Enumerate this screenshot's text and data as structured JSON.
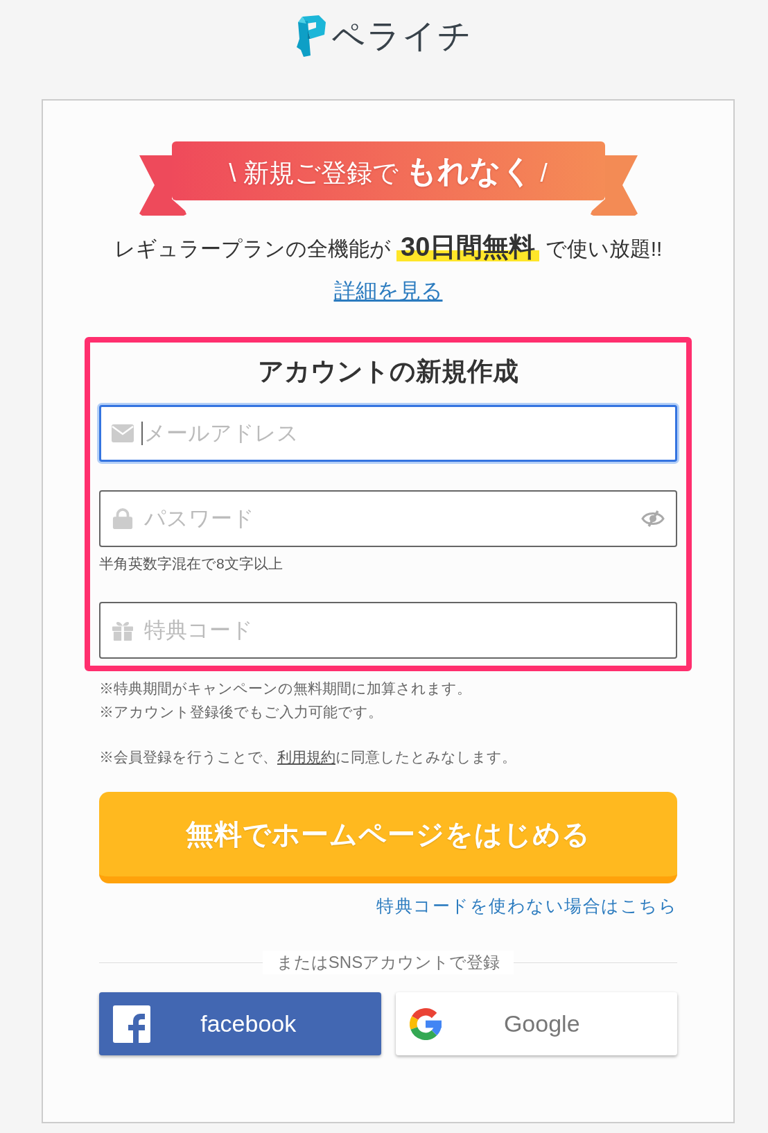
{
  "logo": {
    "wordmark": "ペライチ"
  },
  "banner": {
    "text": "\\ 新規ご登録で **もれなく** /"
  },
  "promo": {
    "text": "レギュラープランの全機能が **30日間無料** で使い放題!!",
    "link": "詳細を見る"
  },
  "signup_form": {
    "highlighted": true,
    "title": "アカウントの新規作成",
    "fields": [
      {
        "kind": "email",
        "placeholder": "メールアドレス",
        "focused": true
      },
      {
        "kind": "password",
        "placeholder": "パスワード",
        "focused": false,
        "hint": "半角英数字混在で8文字以上"
      },
      {
        "kind": "coupon",
        "placeholder": "特典コード",
        "focused": false
      }
    ]
  },
  "notes": [
    "※特典期間がキャンペーンの無料期間に加算されます。",
    "※アカウント登録後でもご入力可能です。"
  ],
  "terms": {
    "before": "※会員登録を行うことで、",
    "link": "利用規約",
    "after": "に同意したとみなします。"
  },
  "submit_button": "無料でホームページをはじめる",
  "no_coupon_link": "特典コードを使わない場合はこちら",
  "sns": {
    "label": "またはSNSアカウントで登録",
    "buttons": [
      {
        "kind": "facebook",
        "label": "facebook"
      },
      {
        "kind": "google",
        "label": "Google"
      }
    ]
  }
}
